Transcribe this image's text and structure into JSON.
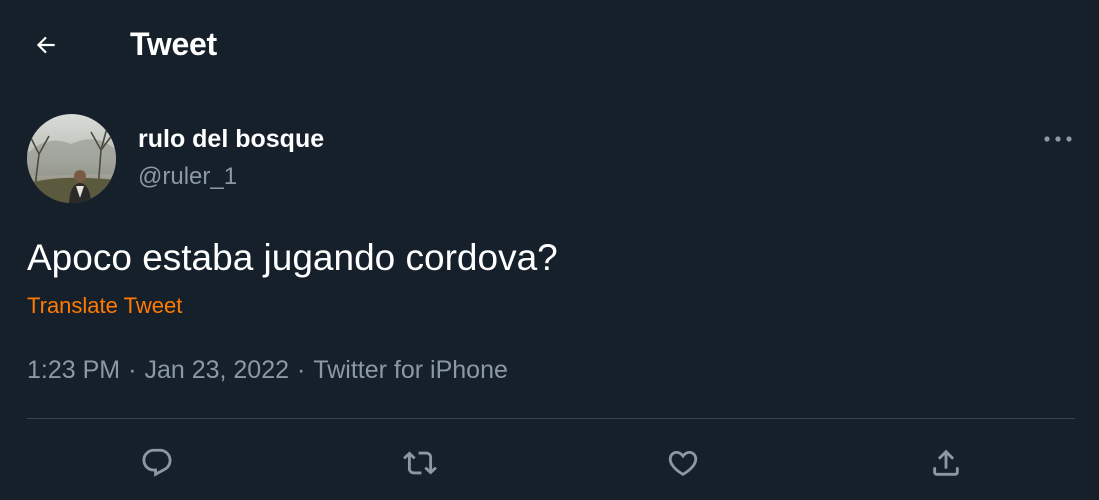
{
  "header": {
    "title": "Tweet",
    "back_icon": "arrow-left-icon"
  },
  "tweet": {
    "author": {
      "display_name": "rulo del bosque",
      "handle": "@ruler_1"
    },
    "text": "Apoco estaba jugando cordova?",
    "translate_label": "Translate Tweet",
    "time": "1:23 PM",
    "date": "Jan 23, 2022",
    "source": "Twitter for iPhone",
    "separator": "·"
  },
  "actions": [
    "reply-icon",
    "retweet-icon",
    "like-icon",
    "share-icon"
  ],
  "colors": {
    "background": "#15202b",
    "text": "#ffffff",
    "secondary_text": "#8b98a5",
    "translate_link": "#ff7a00",
    "divider": "#38444d"
  }
}
